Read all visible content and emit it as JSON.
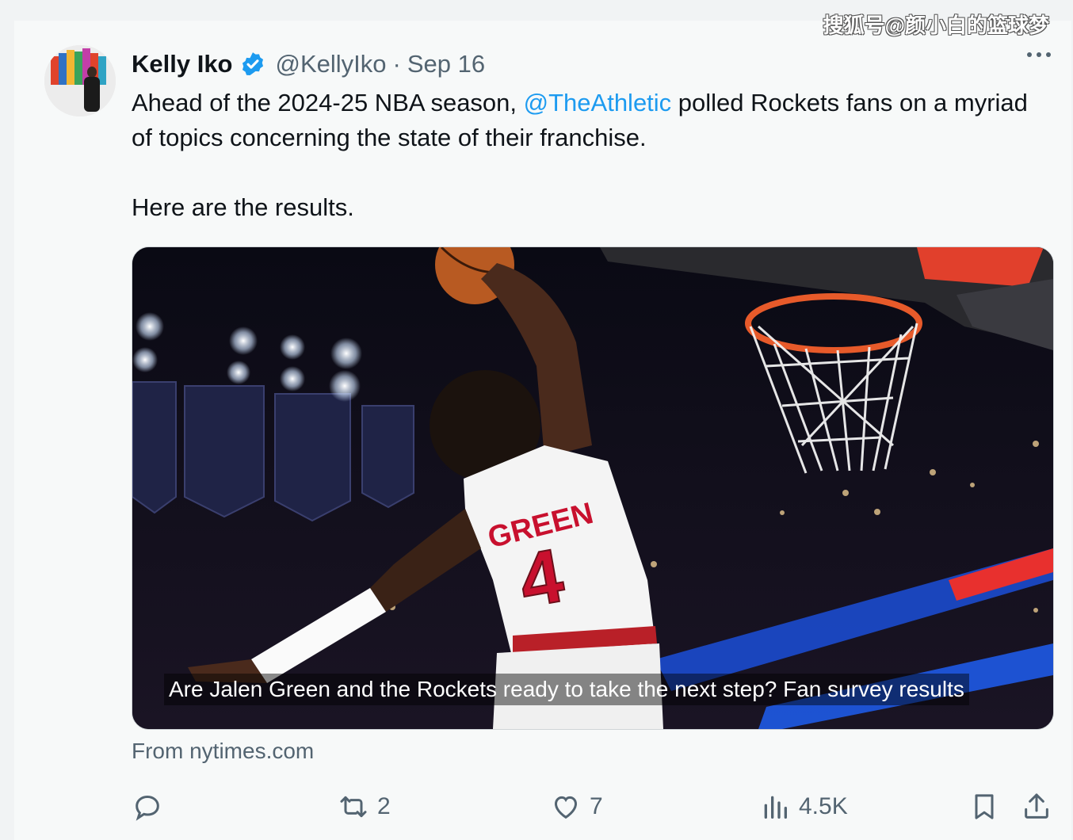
{
  "watermark": "搜狐号@颜小白的篮球梦",
  "tweet": {
    "author_name": "Kelly Iko",
    "verified_icon": "verified-badge-icon",
    "handle": "@KellyIko",
    "separator": "·",
    "date": "Sep 16",
    "text_part1": "Ahead of the 2024-25 NBA season, ",
    "mention": "@TheAthletic",
    "text_part2": " polled Rockets fans on a myriad of topics concerning the state of their franchise.",
    "text_line2": "Here are the results.",
    "card": {
      "caption": "Are Jalen Green and the Rockets ready to take the next step? Fan survey results",
      "jersey_name": "GREEN",
      "jersey_number": "4",
      "source": "From nytimes.com"
    },
    "actions": {
      "reply_count": "",
      "retweet_count": "2",
      "like_count": "7",
      "views_count": "4.5K"
    }
  },
  "colors": {
    "accent": "#1d9bf0",
    "secondary_text": "#536471",
    "jersey_red": "#ce1141"
  }
}
